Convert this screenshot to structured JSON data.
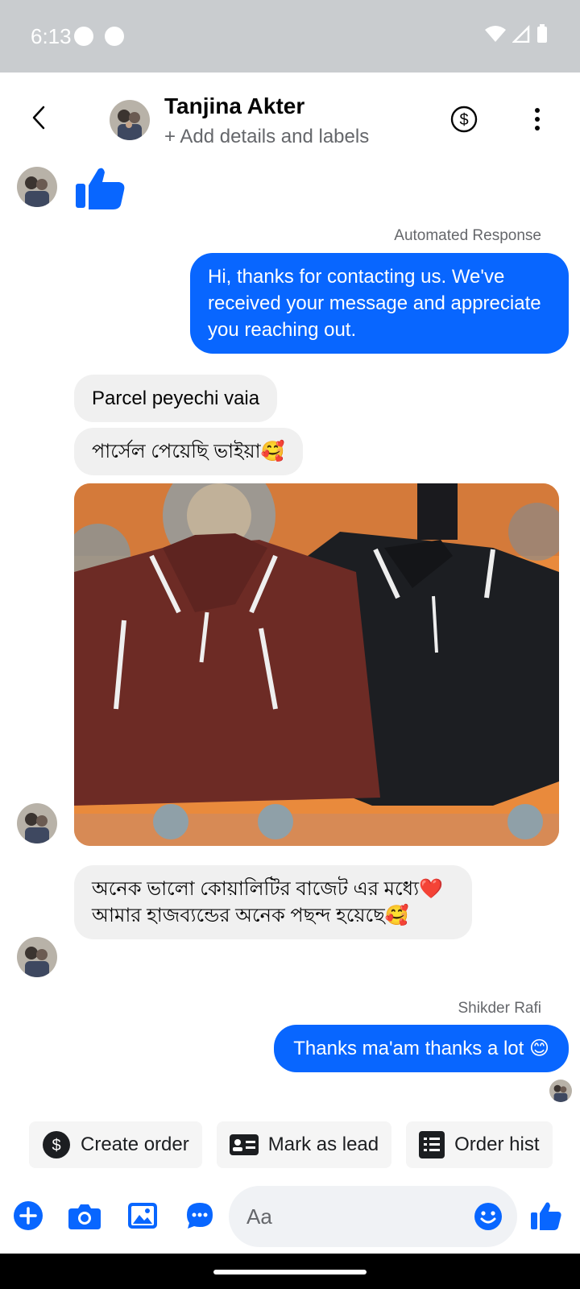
{
  "status_bar": {
    "time": "6:13"
  },
  "header": {
    "contact_name": "Tanjina Akter",
    "subtitle": "+ Add details and labels"
  },
  "messages": {
    "auto_response_caption": "Automated Response",
    "auto_response_text": "Hi, thanks for contacting us. We've received your message and appreciate you reaching out.",
    "incoming_1": "Parcel peyechi vaia",
    "incoming_2": "পার্সেল পেয়েছি ভাইয়া🥰",
    "incoming_3": "অনেক ভালো কোয়ালিটির বাজেট এর মধ্যে❤️ আমার হাজব্যন্ডের অনেক  পছন্দ হয়েছে🥰",
    "reply_caption": "Shikder Rafi",
    "reply_text": "Thanks ma'am thanks a lot 😊"
  },
  "quick_actions": [
    {
      "label": "Create order",
      "icon": "dollar-circle-icon"
    },
    {
      "label": "Mark as lead",
      "icon": "contact-card-icon"
    },
    {
      "label": "Order hist",
      "icon": "list-document-icon"
    }
  ],
  "composer": {
    "placeholder": "Aa"
  },
  "colors": {
    "accent": "#0866ff",
    "incoming_bubble": "#f0f0f0",
    "status_bar": "#c9cccf"
  }
}
